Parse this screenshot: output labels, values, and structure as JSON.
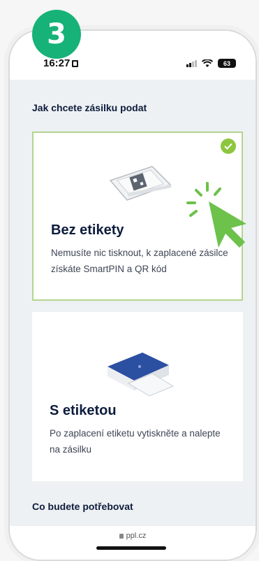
{
  "step": {
    "number": "3"
  },
  "statusbar": {
    "time": "16:27",
    "battery": "63"
  },
  "section_title": "Jak chcete zásilku podat",
  "options": [
    {
      "title": "Bez etikety",
      "description": "Nemusíte nic tisknout, k zaplacené zásilce získáte SmartPIN a QR kód",
      "selected": true
    },
    {
      "title": "S etiketou",
      "description": "Po zaplacení etiketu vytiskněte a nalepte na zásilku",
      "selected": false
    }
  ],
  "next_section_title": "Co budete potřebovat",
  "browser": {
    "url": "ppl.cz"
  },
  "colors": {
    "step_badge": "#16b277",
    "selected_border": "#b2d58d",
    "check": "#8dc63f",
    "pointer": "#6cc24a",
    "title_text": "#0d1c3d"
  }
}
